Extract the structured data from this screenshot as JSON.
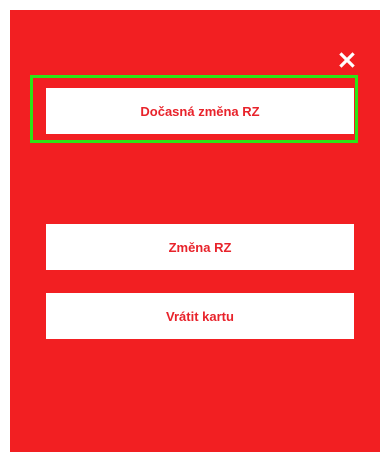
{
  "dialog": {
    "close_icon": "close-icon",
    "buttons": {
      "temporary_change": "Dočasná změna RZ",
      "change": "Změna RZ",
      "return_card": "Vrátit kartu"
    }
  },
  "colors": {
    "panel_background": "#f21f22",
    "button_background": "#ffffff",
    "button_text": "#e8232b",
    "highlight_border": "#2ee515"
  }
}
